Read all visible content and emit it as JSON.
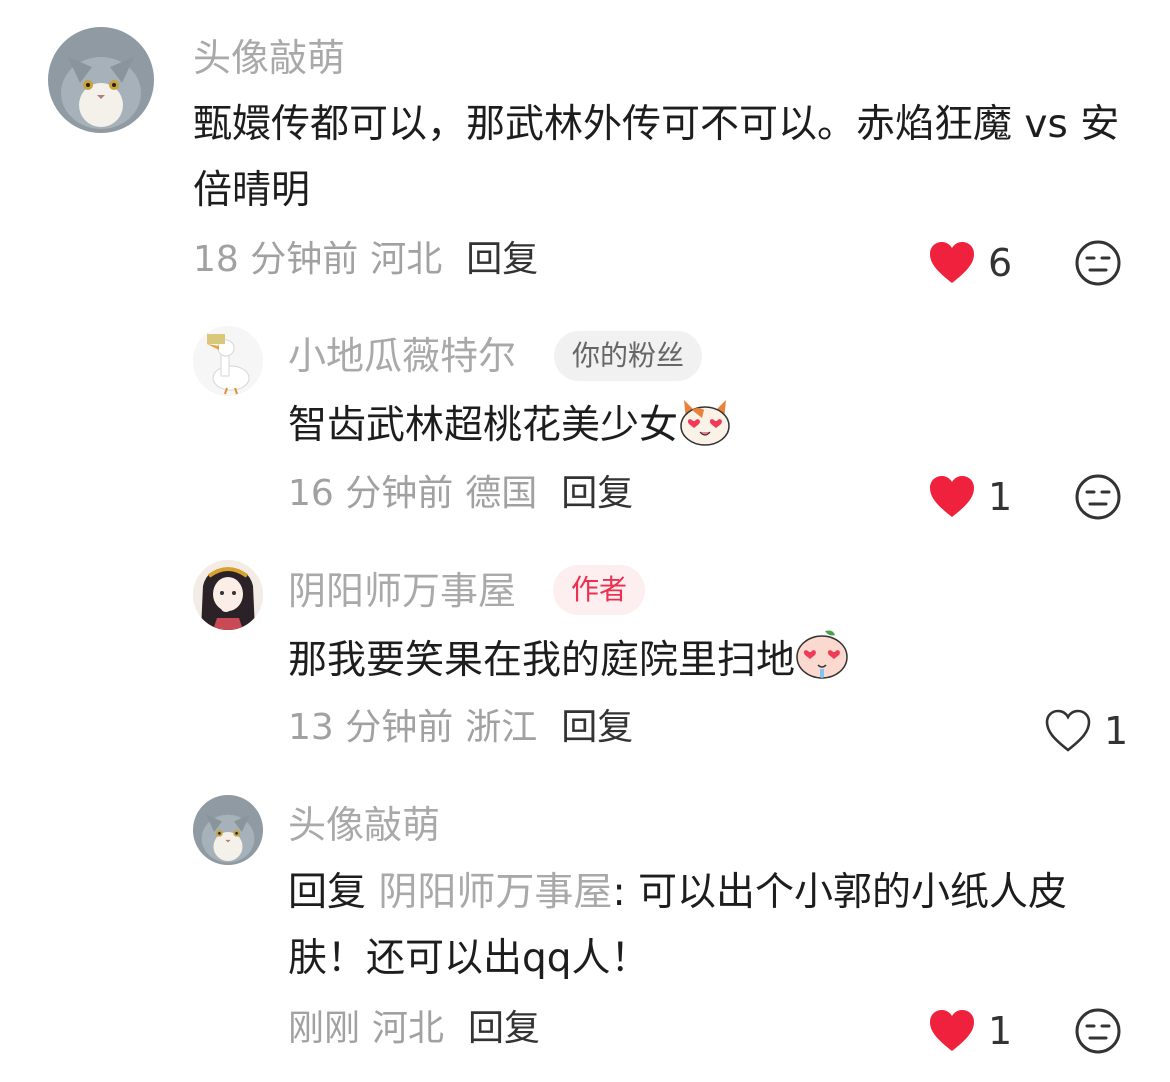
{
  "comments": [
    {
      "username": "头像敲萌",
      "text": "甄嬛传都可以，那武林外传可不可以。赤焰狂魔 vs 安倍晴明",
      "time": "18 分钟前",
      "location": "河北",
      "reply_label": "回复",
      "likes": "6",
      "liked": true
    },
    {
      "username": "小地瓜薇特尔",
      "badge": "你的粉丝",
      "text": "智齿武林超桃花美少女",
      "emoji": "cat-heart-eyes-emoji",
      "time": "16 分钟前",
      "location": "德国",
      "reply_label": "回复",
      "likes": "1",
      "liked": true
    },
    {
      "username": "阴阳师万事屋",
      "badge": "作者",
      "text": "那我要笑果在我的庭院里扫地",
      "emoji": "peach-heart-eyes-emoji",
      "time": "13 分钟前",
      "location": "浙江",
      "reply_label": "回复",
      "likes": "1",
      "liked": false
    },
    {
      "username": "头像敲萌",
      "reply_prefix": "回复",
      "reply_to": "阴阳师万事屋",
      "text": ": 可以出个小郭的小纸人皮肤！还可以出qq人！",
      "time": "刚刚",
      "location": "河北",
      "reply_label": "回复",
      "likes": "1",
      "liked": true
    }
  ],
  "colors": {
    "like_red": "#f0213c",
    "username_gray": "#a9a9a9",
    "author_badge_red": "#ef2f4f"
  }
}
